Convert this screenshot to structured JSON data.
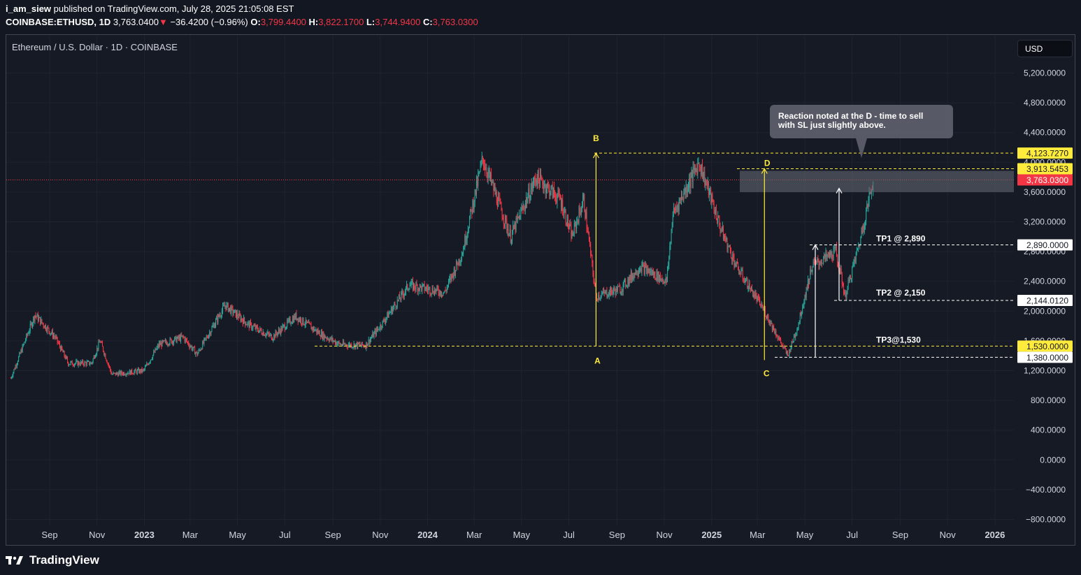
{
  "header": {
    "author": "i_am_siew",
    "published": "published on TradingView.com, July 28, 2025 21:05:08 EST",
    "symbol": "COINBASE:ETHUSD, 1D",
    "last": "3,763.0400",
    "change": "−36.4200 (−0.96%)",
    "o_label": "O:",
    "o_value": "3,799.4400",
    "h_label": "H:",
    "h_value": "3,822.1700",
    "l_label": "L:",
    "l_value": "3,744.9400",
    "c_label": "C:",
    "c_value": "3,763.0300"
  },
  "legend": "Ethereum / U.S. Dollar · 1D · COINBASE",
  "currency_button": "USD",
  "footer_brand": "TradingView",
  "colors": {
    "background": "#161a25",
    "up": "#26a69a",
    "down": "#f23645",
    "yellow": "#ffeb3b",
    "white": "#ffffff",
    "zone": "#6a6d78"
  },
  "chart_data": {
    "type": "candlestick",
    "title": "Ethereum / U.S. Dollar · 1D · COINBASE",
    "ylim": [
      -800,
      5600
    ],
    "y_ticks": [
      "5,200.0000",
      "4,800.0000",
      "4,400.0000",
      "4,000.0000",
      "3,600.0000",
      "3,200.0000",
      "2,800.0000",
      "2,400.0000",
      "2,000.0000",
      "1,600.0000",
      "1,200.0000",
      "800.0000",
      "400.0000",
      "0.0000",
      "−400.0000",
      "−800.0000"
    ],
    "y_tick_values": [
      5200,
      4800,
      4400,
      4000,
      3600,
      3200,
      2800,
      2400,
      2000,
      1600,
      1200,
      800,
      400,
      0,
      -400,
      -800
    ],
    "x_ticks": [
      "Sep",
      "Nov",
      "2023",
      "Mar",
      "May",
      "Jul",
      "Sep",
      "Nov",
      "2024",
      "Mar",
      "May",
      "Jul",
      "Sep",
      "Nov",
      "2025",
      "Mar",
      "May",
      "Jul",
      "Sep",
      "Nov",
      "2026"
    ],
    "x_tick_dates": [
      "2022-09-01",
      "2022-11-01",
      "2023-01-01",
      "2023-03-01",
      "2023-05-01",
      "2023-07-01",
      "2023-09-01",
      "2023-11-01",
      "2024-01-01",
      "2024-03-01",
      "2024-05-01",
      "2024-07-01",
      "2024-09-01",
      "2024-11-01",
      "2025-01-01",
      "2025-03-01",
      "2025-05-01",
      "2025-07-01",
      "2025-09-01",
      "2025-11-01",
      "2026-01-01"
    ],
    "grid": true,
    "price_path": [
      [
        "2022-07-13",
        1100
      ],
      [
        "2022-08-13",
        1950
      ],
      [
        "2022-09-08",
        1650
      ],
      [
        "2022-09-25",
        1300
      ],
      [
        "2022-10-25",
        1300
      ],
      [
        "2022-11-05",
        1600
      ],
      [
        "2022-11-20",
        1150
      ],
      [
        "2022-12-31",
        1200
      ],
      [
        "2023-01-20",
        1550
      ],
      [
        "2023-02-20",
        1650
      ],
      [
        "2023-03-10",
        1420
      ],
      [
        "2023-04-15",
        2080
      ],
      [
        "2023-05-15",
        1820
      ],
      [
        "2023-06-15",
        1650
      ],
      [
        "2023-07-15",
        1930
      ],
      [
        "2023-08-18",
        1680
      ],
      [
        "2023-09-11",
        1550
      ],
      [
        "2023-10-13",
        1540
      ],
      [
        "2023-11-01",
        1800
      ],
      [
        "2023-12-08",
        2350
      ],
      [
        "2024-01-23",
        2250
      ],
      [
        "2024-02-15",
        2800
      ],
      [
        "2024-03-12",
        4050
      ],
      [
        "2024-04-17",
        3000
      ],
      [
        "2024-05-20",
        3800
      ],
      [
        "2024-06-20",
        3500
      ],
      [
        "2024-07-05",
        3000
      ],
      [
        "2024-07-20",
        3500
      ],
      [
        "2024-08-05",
        2200
      ],
      [
        "2024-09-06",
        2300
      ],
      [
        "2024-10-01",
        2600
      ],
      [
        "2024-11-04",
        2400
      ],
      [
        "2024-11-12",
        3300
      ],
      [
        "2024-12-16",
        4000
      ],
      [
        "2025-01-13",
        3100
      ],
      [
        "2025-02-02",
        2600
      ],
      [
        "2025-03-10",
        2000
      ],
      [
        "2025-04-09",
        1400
      ],
      [
        "2025-04-22",
        1800
      ],
      [
        "2025-05-10",
        2600
      ],
      [
        "2025-06-10",
        2800
      ],
      [
        "2025-06-22",
        2200
      ],
      [
        "2025-07-10",
        2900
      ],
      [
        "2025-07-28",
        3763
      ]
    ],
    "last_price": 3763.03,
    "price_labels": [
      {
        "label": "4,123.7270",
        "value": 4123.727,
        "style": "yellow"
      },
      {
        "label": "3,913.5453",
        "value": 3913.5453,
        "style": "yellow"
      },
      {
        "label": "3,763.0300",
        "value": 3763.03,
        "style": "red"
      },
      {
        "label": "2,890.0000",
        "value": 2890,
        "style": "white"
      },
      {
        "label": "2,144.0120",
        "value": 2144.012,
        "style": "white"
      },
      {
        "label": "1,530.0000",
        "value": 1530,
        "style": "yellow"
      },
      {
        "label": "1,380.0000",
        "value": 1380,
        "style": "white"
      }
    ],
    "pattern_points": [
      {
        "label": "A",
        "date": "2024-08-05",
        "value": 1530
      },
      {
        "label": "B",
        "date": "2024-08-05",
        "value": 4123.727
      },
      {
        "label": "C",
        "date": "2025-03-10",
        "value": 1380
      },
      {
        "label": "D",
        "date": "2025-03-10",
        "value": 3913.5453
      }
    ],
    "targets": [
      {
        "label": "TP1 @ 2,890",
        "value": 2890
      },
      {
        "label": "TP2 @ 2,150",
        "value": 2144.012
      },
      {
        "label": "TP3@1,530",
        "value": 1530
      }
    ],
    "annotation": "Reaction noted at the D -  time to sell with SL just slightly above."
  }
}
